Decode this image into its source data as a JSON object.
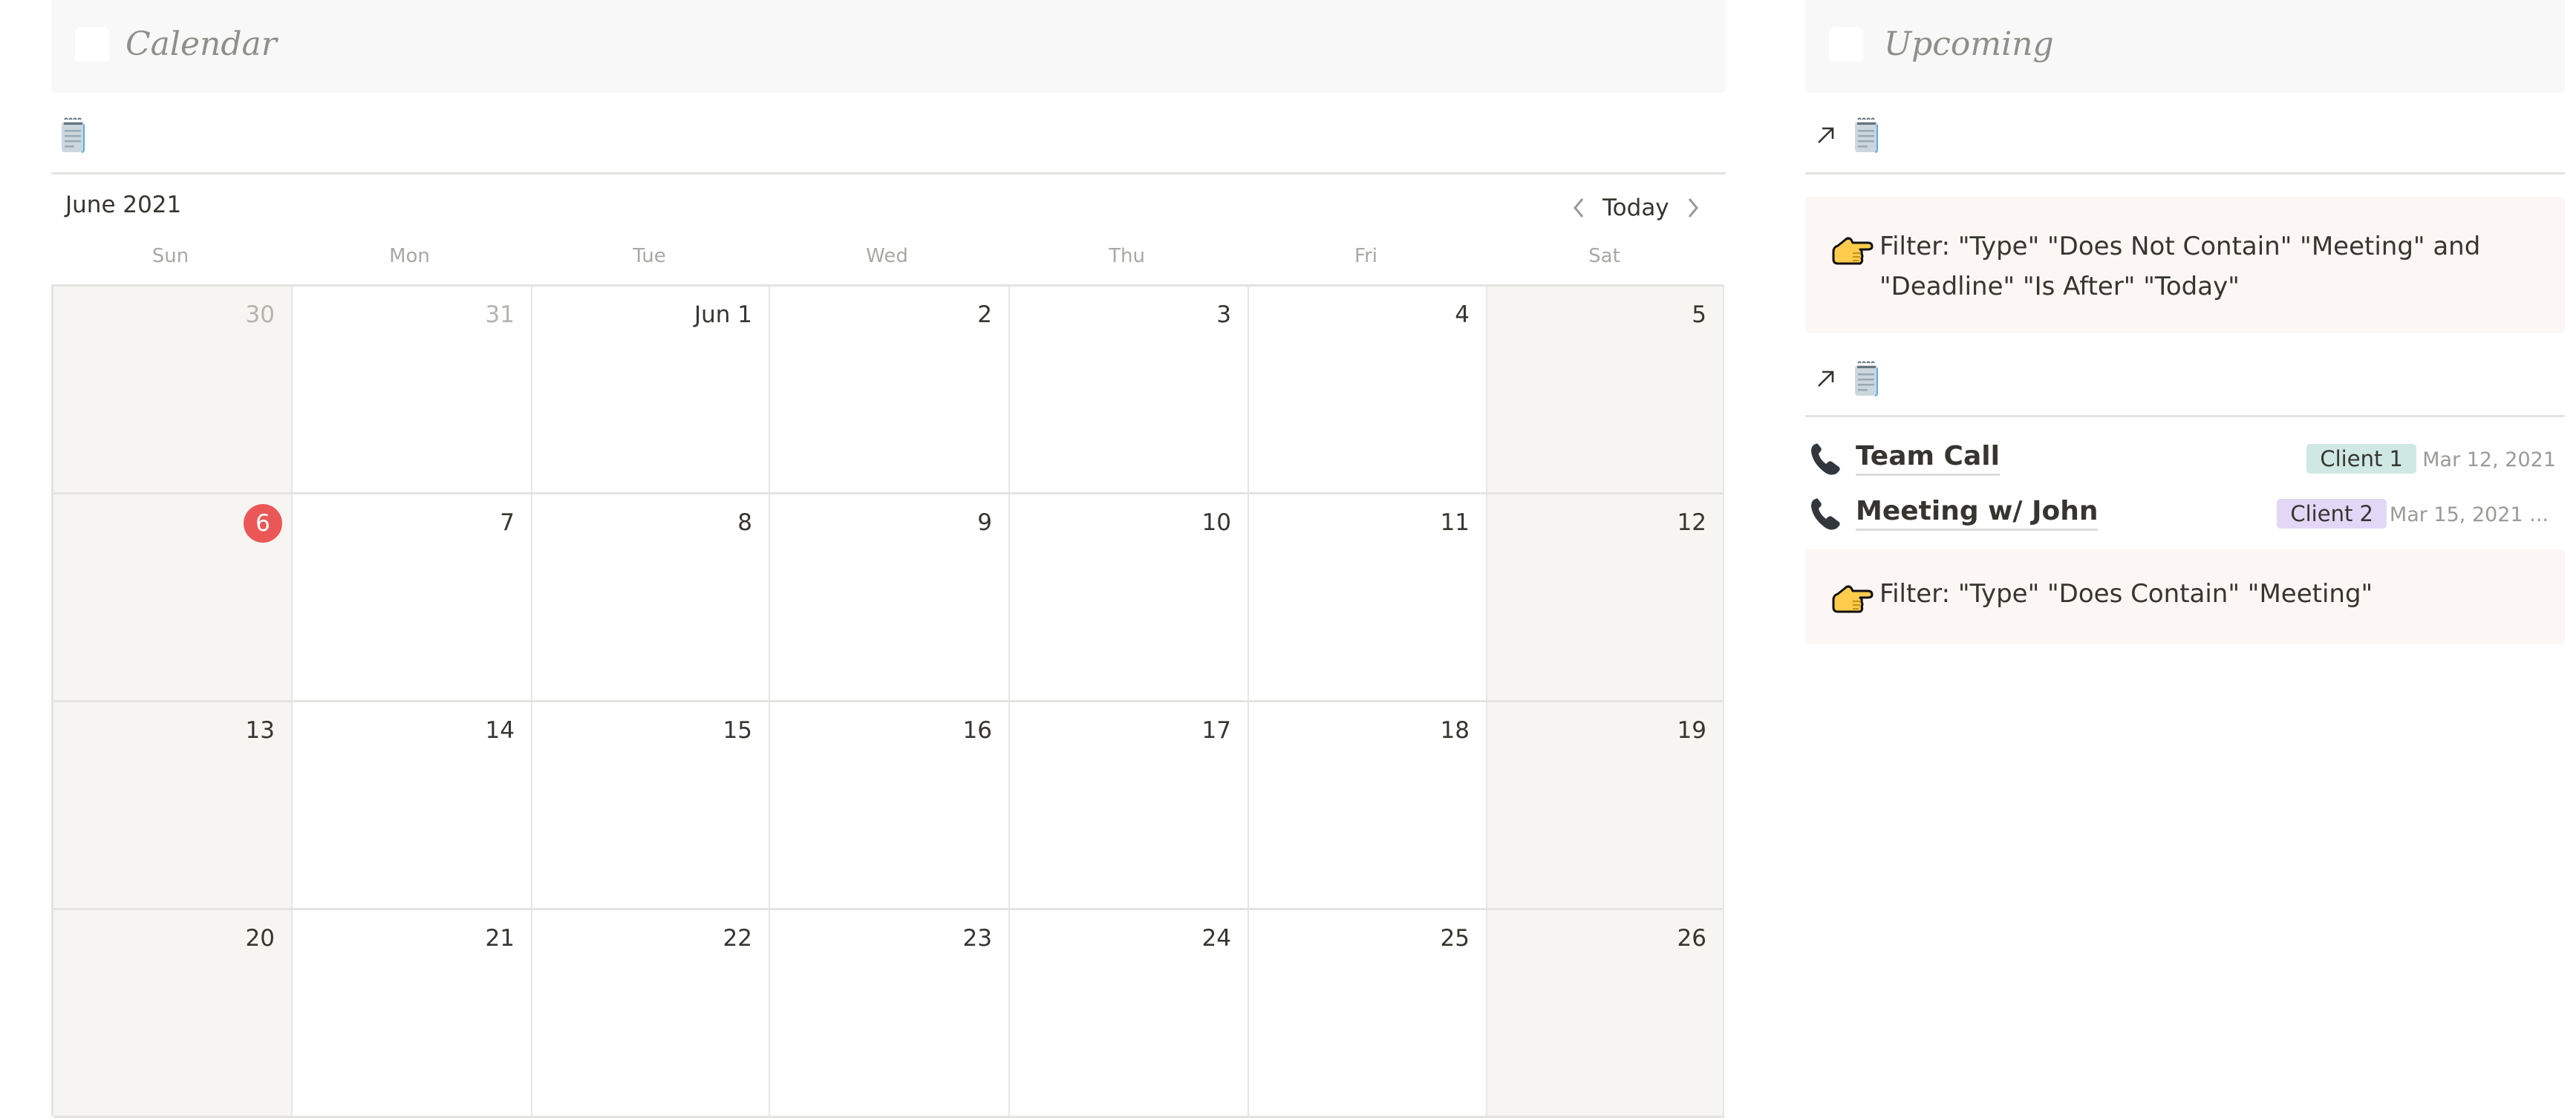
{
  "calendar": {
    "title": "Calendar",
    "month_label": "June 2021",
    "nav": {
      "prev_icon": "chevron-left-icon",
      "today_label": "Today",
      "next_icon": "chevron-right-icon"
    },
    "view_icon": "notepad-icon",
    "weekdays": [
      "Sun",
      "Mon",
      "Tue",
      "Wed",
      "Thu",
      "Fri",
      "Sat"
    ],
    "today_color": "#eb5757",
    "weeks": [
      [
        {
          "label": "30",
          "muted": true
        },
        {
          "label": "31",
          "muted": true
        },
        {
          "label": "Jun 1"
        },
        {
          "label": "2"
        },
        {
          "label": "3"
        },
        {
          "label": "4"
        },
        {
          "label": "5"
        }
      ],
      [
        {
          "label": "6",
          "today": true
        },
        {
          "label": "7"
        },
        {
          "label": "8"
        },
        {
          "label": "9"
        },
        {
          "label": "10"
        },
        {
          "label": "11"
        },
        {
          "label": "12"
        }
      ],
      [
        {
          "label": "13"
        },
        {
          "label": "14"
        },
        {
          "label": "15"
        },
        {
          "label": "16"
        },
        {
          "label": "17"
        },
        {
          "label": "18"
        },
        {
          "label": "19"
        }
      ],
      [
        {
          "label": "20"
        },
        {
          "label": "21"
        },
        {
          "label": "22"
        },
        {
          "label": "23"
        },
        {
          "label": "24"
        },
        {
          "label": "25"
        },
        {
          "label": "26"
        }
      ]
    ]
  },
  "upcoming": {
    "title": "Upcoming",
    "views": [
      {
        "link_icon": "arrow-up-right-icon",
        "view_icon": "notepad-icon",
        "callout_icon": "pointing-hand-icon",
        "callout_text": "Filter: \"Type\" \"Does Not Contain\" \"Meeting\" and \"Deadline\" \"Is After\" \"Today\"",
        "items": []
      },
      {
        "link_icon": "arrow-up-right-icon",
        "view_icon": "notepad-icon",
        "items": [
          {
            "icon": "phone-icon",
            "title": "Team Call",
            "tag": "Client 1",
            "tag_color": "#cfe8e3",
            "date": "Mar 12, 2021"
          },
          {
            "icon": "phone-icon",
            "title": "Meeting w/ John",
            "tag": "Client 2",
            "tag_color": "#e3d7f7",
            "date": "Mar 15, 2021 ..."
          }
        ],
        "callout_icon": "pointing-hand-icon",
        "callout_text": "Filter: \"Type\" \"Does Contain\" \"Meeting\""
      }
    ]
  }
}
